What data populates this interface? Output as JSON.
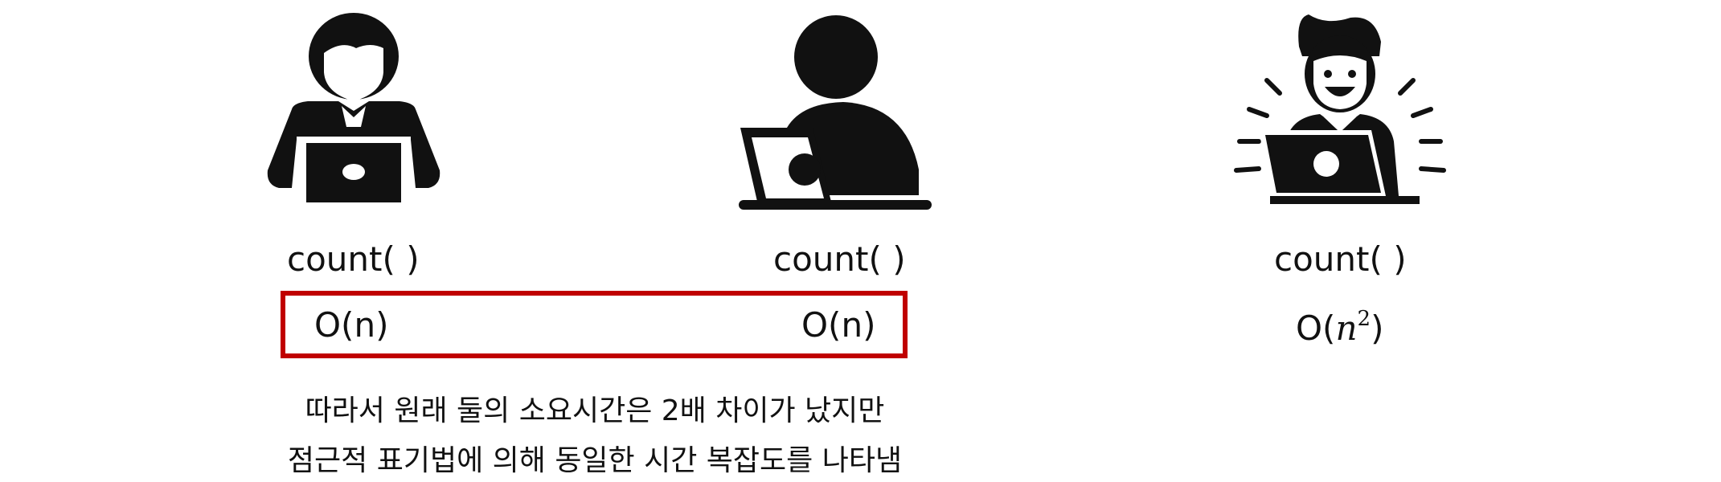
{
  "figures": [
    {
      "icon": "woman-laptop-icon",
      "method_label": "count( )",
      "complexity_label": "O(n)"
    },
    {
      "icon": "person-laptop-icon",
      "method_label": "count( )",
      "complexity_label": "O(n)"
    },
    {
      "icon": "happy-man-laptop-icon",
      "method_label": "count( )",
      "complexity_prefix": "O(",
      "complexity_base": "n",
      "complexity_exponent": "2",
      "complexity_suffix": ")"
    }
  ],
  "caption": {
    "line1": "따라서 원래 둘의 소요시간은 2배 차이가 났지만",
    "line2": "점근적 표기법에 의해 동일한 시간 복잡도를 나타냄"
  },
  "colors": {
    "highlight_border": "#c00000",
    "icon_fill": "#111111"
  }
}
